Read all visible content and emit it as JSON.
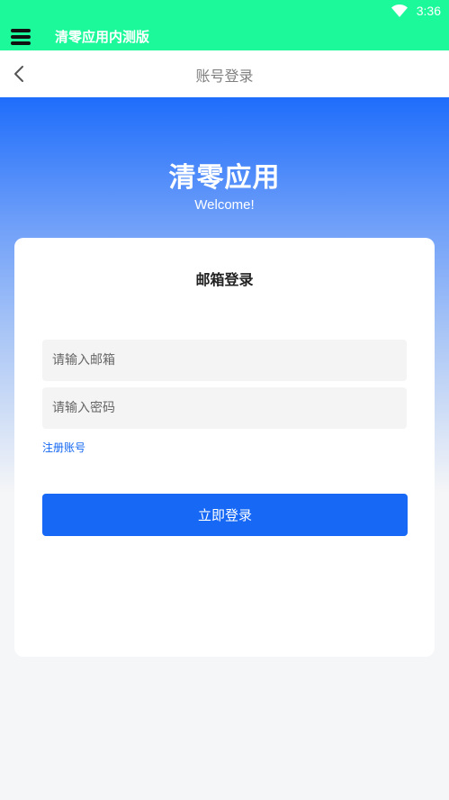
{
  "status_bar": {
    "time": "3:36",
    "wifi_icon": "wifi-icon"
  },
  "app_bar": {
    "menu_icon": "menu-icon",
    "title": "清零应用内测版",
    "color": "#1cf99a"
  },
  "nav_bar": {
    "back_icon": "chevron-left-icon",
    "title": "账号登录"
  },
  "hero": {
    "title": "清零应用",
    "subtitle": "Welcome!",
    "gradient_top": "#1e6dfb"
  },
  "login_card": {
    "title": "邮箱登录",
    "email_placeholder": "请输入邮箱",
    "email_value": "",
    "password_placeholder": "请输入密码",
    "password_value": "",
    "register_link": "注册账号",
    "submit_label": "立即登录",
    "accent": "#1668f5"
  }
}
